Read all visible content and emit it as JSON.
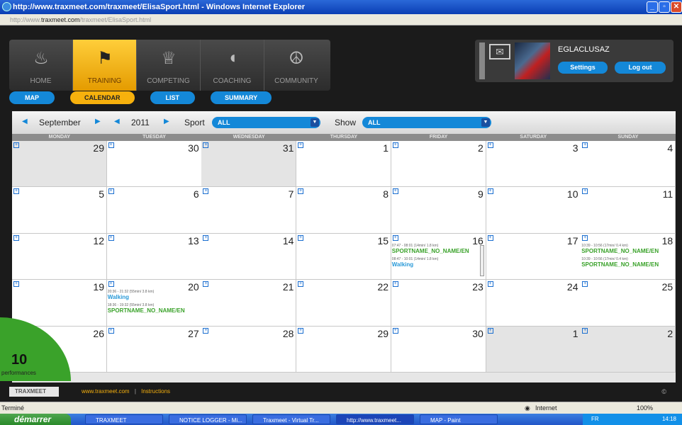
{
  "window": {
    "title": "http://www.traxmeet.com/traxmeet/ElisaSport.html - Windows Internet Explorer"
  },
  "address": {
    "prefix": "http://www.",
    "domain": "traxmeet.com",
    "path": "/traxmeet/ElisaSport.html"
  },
  "nav": {
    "items": [
      {
        "label": "HOME",
        "icon": "flame-icon",
        "glyph": "♨"
      },
      {
        "label": "TRAINING",
        "icon": "runner-icon",
        "glyph": "🏃"
      },
      {
        "label": "COMPETING",
        "icon": "trophy-icon",
        "glyph": "🏆"
      },
      {
        "label": "COACHING",
        "icon": "whistle-icon",
        "glyph": "◖"
      },
      {
        "label": "COMMUNITY",
        "icon": "community-icon",
        "glyph": "☮"
      }
    ]
  },
  "subtabs": [
    "MAP",
    "CALENDAR",
    "LIST",
    "SUMMARY"
  ],
  "user": {
    "name": "EGLACLUSAZ",
    "settings": "Settings",
    "logout": "Log out"
  },
  "toolbar": {
    "month": "September",
    "year": "2011",
    "sport_label": "Sport",
    "sport_value": "ALL",
    "show_label": "Show",
    "show_value": "ALL"
  },
  "days": [
    "MONDAY",
    "TUESDAY",
    "WEDNESDAY",
    "THURSDAY",
    "FRIDAY",
    "SATURDAY",
    "SUNDAY"
  ],
  "weeks": [
    [
      "29",
      "30",
      "31",
      "1",
      "2",
      "3",
      "4"
    ],
    [
      "5",
      "6",
      "7",
      "8",
      "9",
      "10",
      "11"
    ],
    [
      "12",
      "13",
      "14",
      "15",
      "16",
      "17",
      "18"
    ],
    [
      "19",
      "20",
      "21",
      "22",
      "23",
      "24",
      "25"
    ],
    [
      "26",
      "27",
      "28",
      "29",
      "30",
      "1",
      "2"
    ]
  ],
  "events": {
    "fri16": [
      {
        "time": "07:47 - 08:01 (14min/ 1.8 km)",
        "name": "SPORTNAME_NO_NAME/EN"
      },
      {
        "time": "08:47 - 10:01 (14min/ 1.8 km)",
        "name": "Walking"
      }
    ],
    "sun18": [
      {
        "time": "10:39 - 10:56 (17min/ 0.4 km)",
        "name": "SPORTNAME_NO_NAME/EN"
      },
      {
        "time": "10:39 - 10:56 (17min/ 0.4 km)",
        "name": "SPORTNAME_NO_NAME/EN"
      }
    ],
    "tue20": [
      {
        "time": "20:36 - 21:32 (55min/ 3.8 km)",
        "name": "Walking"
      },
      {
        "time": "18:36 - 19:32 (55min/ 3.8 km)",
        "name": "SPORTNAME_NO_NAME/EN"
      }
    ]
  },
  "performances": {
    "count": "10",
    "label": "performances"
  },
  "footer": {
    "logo": "TRAXMEET",
    "link": "www.traxmeet.com",
    "sep": "|",
    "instructions": "Instructions",
    "copyright": "©"
  },
  "status": {
    "text": "Terminé",
    "zone": "Internet",
    "zoom": "100%"
  },
  "taskbar": {
    "start": "démarrer",
    "items": [
      "TRAXMEET",
      "NOTICE LOGGER - Mi...",
      "Traxmeet - Virtual Tr...",
      "http://www.traxmeet...",
      "MAP - Paint"
    ],
    "lang": "FR",
    "clock": "14:18"
  },
  "colors": {
    "accent": "#1488d8",
    "active_tab": "#f7b10d",
    "green": "#3aa22a",
    "walking": "#2a9ad8"
  }
}
